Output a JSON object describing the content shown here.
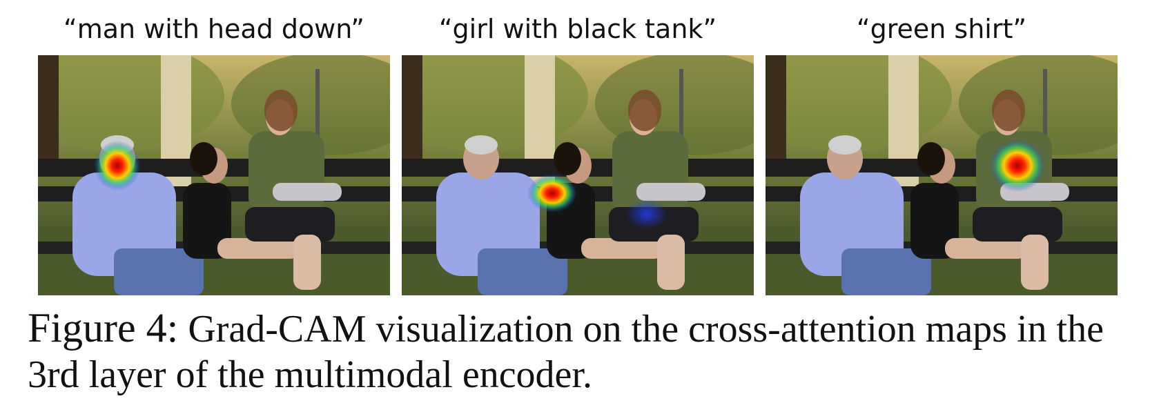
{
  "panels": [
    {
      "label": "“man with head down”",
      "heat": "man-head"
    },
    {
      "label": "“girl with black tank”",
      "heat": "girl-shoulder"
    },
    {
      "label": "“green shirt”",
      "heat": "woman-chest"
    }
  ],
  "caption": {
    "figure": "Figure 4:",
    "text": " Grad-CAM visualization on the cross-attention maps in the 3rd layer of the multimodal encoder."
  }
}
